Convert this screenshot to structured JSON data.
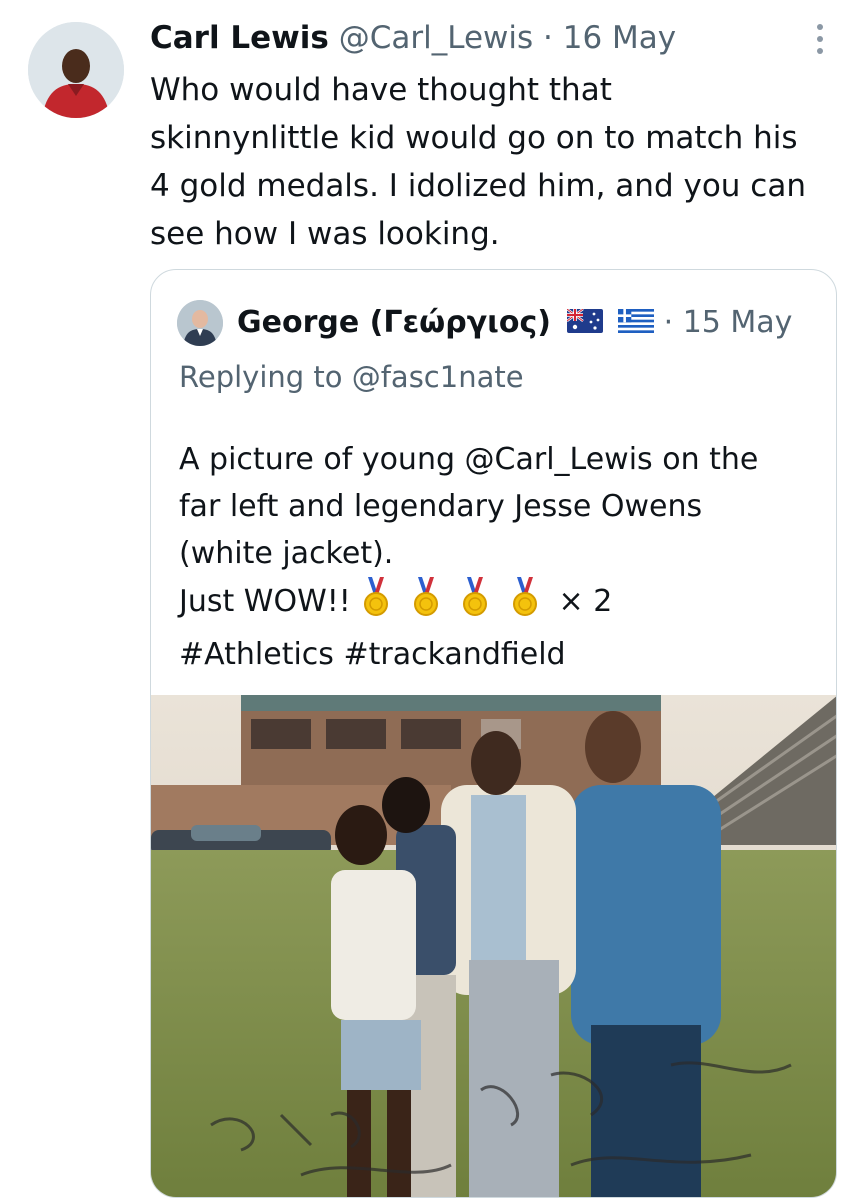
{
  "tweet": {
    "author_name": "Carl Lewis",
    "author_handle": "@Carl_Lewis",
    "separator": "·",
    "date": "16 May",
    "text": "Who would have thought that\nskinnynlittle kid would go on to match his\n4 gold medals. I idolized him, and you can\nsee how I was looking."
  },
  "quoted_tweet": {
    "author_name": "George (Γεώργιος)",
    "separator": "·",
    "date": "15 May",
    "replying_to": "Replying to @fasc1nate",
    "text_lines": [
      "A picture of young @Carl_Lewis on the",
      "far left and legendary Jesse Owens",
      "(white jacket).",
      "Just WOW!!",
      "#Athletics #trackandfield"
    ],
    "medal_suffix": "× 2",
    "photo_caption_handwriting": "Carl Jim Smith Jesse Owens"
  },
  "icons": {
    "more": "more-vertical-icon",
    "medal": "gold-medal-icon",
    "flag_au": "australia-flag-icon",
    "flag_gr": "greece-flag-icon"
  },
  "colors": {
    "text": "#0f1419",
    "secondary": "#536471",
    "border": "#cfd9de"
  }
}
